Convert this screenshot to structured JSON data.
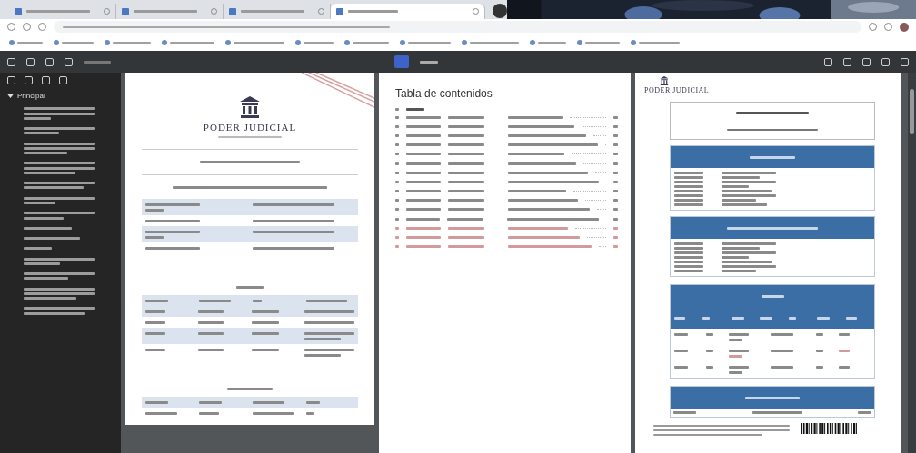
{
  "browser": {
    "tabs": [
      {
        "selected": false
      },
      {
        "selected": false
      },
      {
        "selected": false
      },
      {
        "selected": true
      }
    ]
  },
  "sidebar": {
    "outline_root": {
      "label": "Principal",
      "expanded": true
    }
  },
  "pages": [
    {
      "logo_text": "PODER JUDICIAL"
    },
    {
      "title": "Tabla de contenidos"
    },
    {
      "logo_text": "PODER JUDICIAL"
    }
  ]
}
